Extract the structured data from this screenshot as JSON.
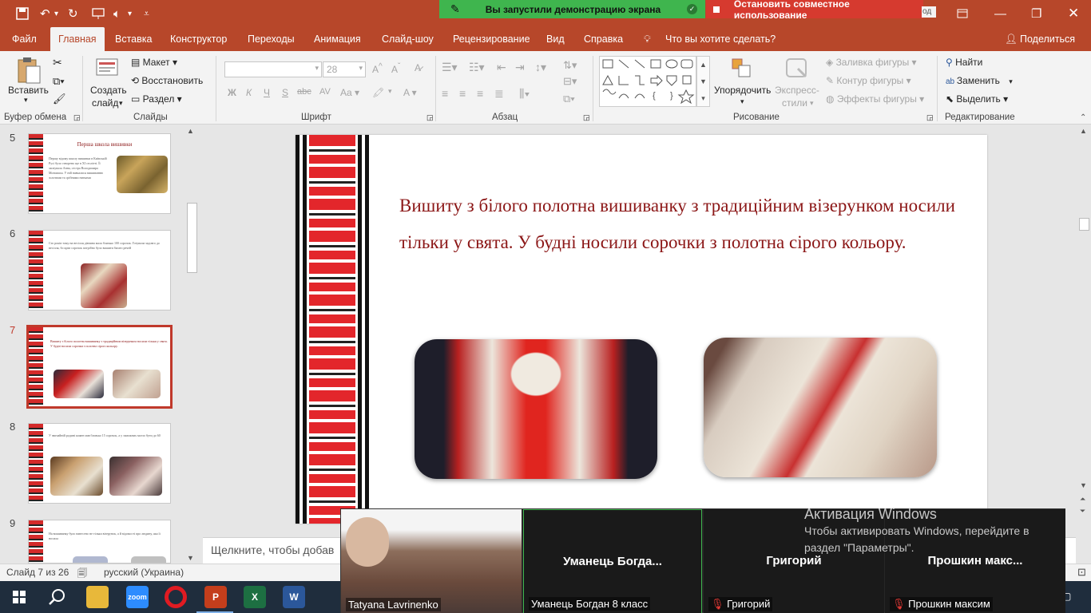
{
  "quick_access": {
    "save_icon": "save-icon",
    "undo_icon": "undo-icon",
    "redo_icon": "redo-icon",
    "present_icon": "present-icon",
    "audio_icon": "audio-icon",
    "customize_icon": "chevron-down-icon"
  },
  "share_banner": {
    "text": "Вы запустили демонстрацию экрана",
    "stop_label": "Остановить совместное использование",
    "partial": "од"
  },
  "menu": {
    "tabs": [
      "Файл",
      "Главная",
      "Вставка",
      "Конструктор",
      "Переходы",
      "Анимация",
      "Слайд-шоу",
      "Рецензирование",
      "Вид",
      "Справка"
    ],
    "tell_me": "Что вы хотите сделать?",
    "share": "Поделиться"
  },
  "ribbon": {
    "clipboard": {
      "paste": "Вставить",
      "group": "Буфер обмена"
    },
    "slides": {
      "new_slide_line1": "Создать",
      "new_slide_line2": "слайд",
      "layout": "Макет",
      "reset": "Восстановить",
      "section": "Раздел",
      "group": "Слайды"
    },
    "font": {
      "font_name": "",
      "font_size": "28",
      "bold": "Ж",
      "italic": "К",
      "underline": "Ч",
      "shadow": "S",
      "strike": "abc",
      "spacing": "AV",
      "case": "Aa",
      "color": "A",
      "group": "Шрифт"
    },
    "paragraph": {
      "group": "Абзац"
    },
    "drawing": {
      "arrange_line1": "Упорядочить",
      "styles_line1": "Экспресс-",
      "styles_line2": "стили",
      "fill": "Заливка фигуры",
      "outline": "Контур фигуры",
      "effects": "Эффекты фигуры",
      "group": "Рисование"
    },
    "editing": {
      "find": "Найти",
      "replace": "Заменить",
      "select": "Выделить",
      "group": "Редактирование"
    }
  },
  "thumbnails": [
    {
      "num": "5",
      "title": "Перша школа вишивки",
      "text": "Першу відому школу вишивки в Київській Русі було створено ще в XI столітті. Її заснувала Анна, сестра Володимира Мономаха. У ній навчалися вишиванню золотими та срібними нитками"
    },
    {
      "num": "6",
      "text": "Сто років тому на весілля дівчина мала близько 100 сорочок. Готували задовго до весілля, бо крім сорочок потрібно було вишити багато речей"
    },
    {
      "num": "7",
      "text": "Вишиту з білого полотна вишиванку з традиційним візерунком носили тільки у свята. У будні носили сорочки з полотна сірого кольору."
    },
    {
      "num": "8",
      "text": "У звичайній родині кожен мав близько 15 сорочок, а у заможних могло бути до 60"
    },
    {
      "num": "9",
      "text": "На вишиванку було нанесено не тільки візерунок, а й відомості про людину, яка її носила"
    }
  ],
  "slide": {
    "text": "Вишиту з білого полотна вишиванку з традиційним візерунком носили тільки у свята. У будні носили сорочки з полотна сірого кольору."
  },
  "notes": {
    "placeholder": "Щелкните, чтобы добав"
  },
  "status": {
    "slide_info": "Слайд 7 из 26",
    "language": "русский (Украина)"
  },
  "zoom": {
    "participants": [
      {
        "label": "Tatyana Lavrinenko",
        "name": ""
      },
      {
        "label": "Уманець Богдан 8 класс",
        "name": "Уманець Богда..."
      },
      {
        "label": "Григорий",
        "name": "Григорий"
      },
      {
        "label": "Прошкин максим",
        "name": "Прошкин макс..."
      }
    ]
  },
  "activation": {
    "title": "Активация Windows",
    "line1": "Чтобы активировать Windows, перейдите в",
    "line2": "раздел \"Параметры\"."
  },
  "colors": {
    "accent": "#b7472a",
    "share_green": "#3fb54e",
    "stop_red": "#d63a2f",
    "slide_text": "#8b1616"
  }
}
